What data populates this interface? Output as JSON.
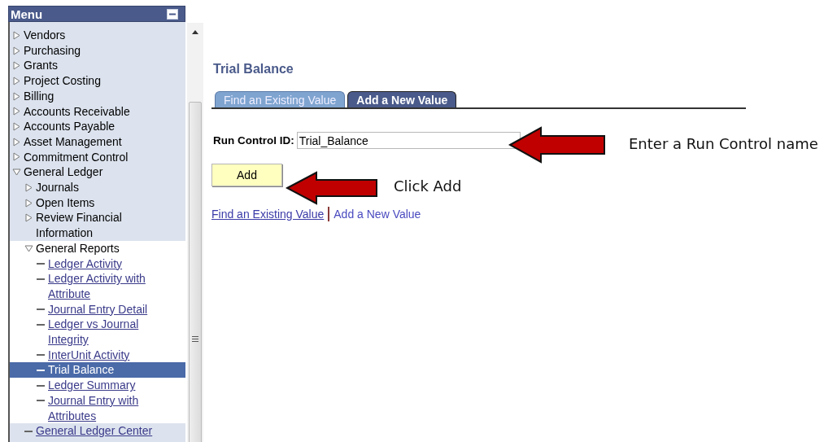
{
  "menu": {
    "title": "Menu",
    "items": [
      {
        "label": "Vendors",
        "kind": "folder",
        "expanded": false
      },
      {
        "label": "Purchasing",
        "kind": "folder",
        "expanded": false
      },
      {
        "label": "Grants",
        "kind": "folder",
        "expanded": false
      },
      {
        "label": "Project Costing",
        "kind": "folder",
        "expanded": false
      },
      {
        "label": "Billing",
        "kind": "folder",
        "expanded": false
      },
      {
        "label": "Accounts Receivable",
        "kind": "folder",
        "expanded": false
      },
      {
        "label": "Accounts Payable",
        "kind": "folder",
        "expanded": false
      },
      {
        "label": "Asset Management",
        "kind": "folder",
        "expanded": false
      },
      {
        "label": "Commitment Control",
        "kind": "folder",
        "expanded": false
      },
      {
        "label": "General Ledger",
        "kind": "folder",
        "expanded": true,
        "children": [
          {
            "label": "Journals",
            "kind": "folder",
            "expanded": false
          },
          {
            "label": "Open Items",
            "kind": "folder",
            "expanded": false
          },
          {
            "label": "Review Financial Information",
            "kind": "folder",
            "expanded": false
          },
          {
            "label": "General Reports",
            "kind": "folder",
            "expanded": true,
            "children": [
              {
                "label": "Ledger Activity",
                "kind": "link",
                "selected": false
              },
              {
                "label": "Ledger Activity with Attribute",
                "kind": "link",
                "selected": false
              },
              {
                "label": "Journal Entry Detail",
                "kind": "link",
                "selected": false
              },
              {
                "label": "Ledger vs Journal Integrity",
                "kind": "link",
                "selected": false
              },
              {
                "label": "InterUnit Activity",
                "kind": "link",
                "selected": false
              },
              {
                "label": "Trial Balance",
                "kind": "link",
                "selected": true
              },
              {
                "label": "Ledger Summary",
                "kind": "link",
                "selected": false
              },
              {
                "label": "Journal Entry with Attributes",
                "kind": "link",
                "selected": false
              }
            ]
          },
          {
            "label": "General Ledger Center",
            "kind": "link",
            "selected": false
          }
        ]
      }
    ]
  },
  "page": {
    "title": "Trial Balance",
    "tabs": [
      {
        "label": "Find an Existing Value",
        "selected": false
      },
      {
        "label": "Add a New Value",
        "selected": true
      }
    ],
    "run_control": {
      "label": "Run Control ID:",
      "value": "Trial_Balance"
    },
    "add_button": "Add",
    "links": [
      {
        "label": "Find an Existing Value",
        "selected": false
      },
      {
        "label": "Add a New Value",
        "selected": true
      }
    ]
  },
  "annotations": [
    {
      "text": "Enter a Run Control name"
    },
    {
      "text": "Click Add"
    }
  ]
}
